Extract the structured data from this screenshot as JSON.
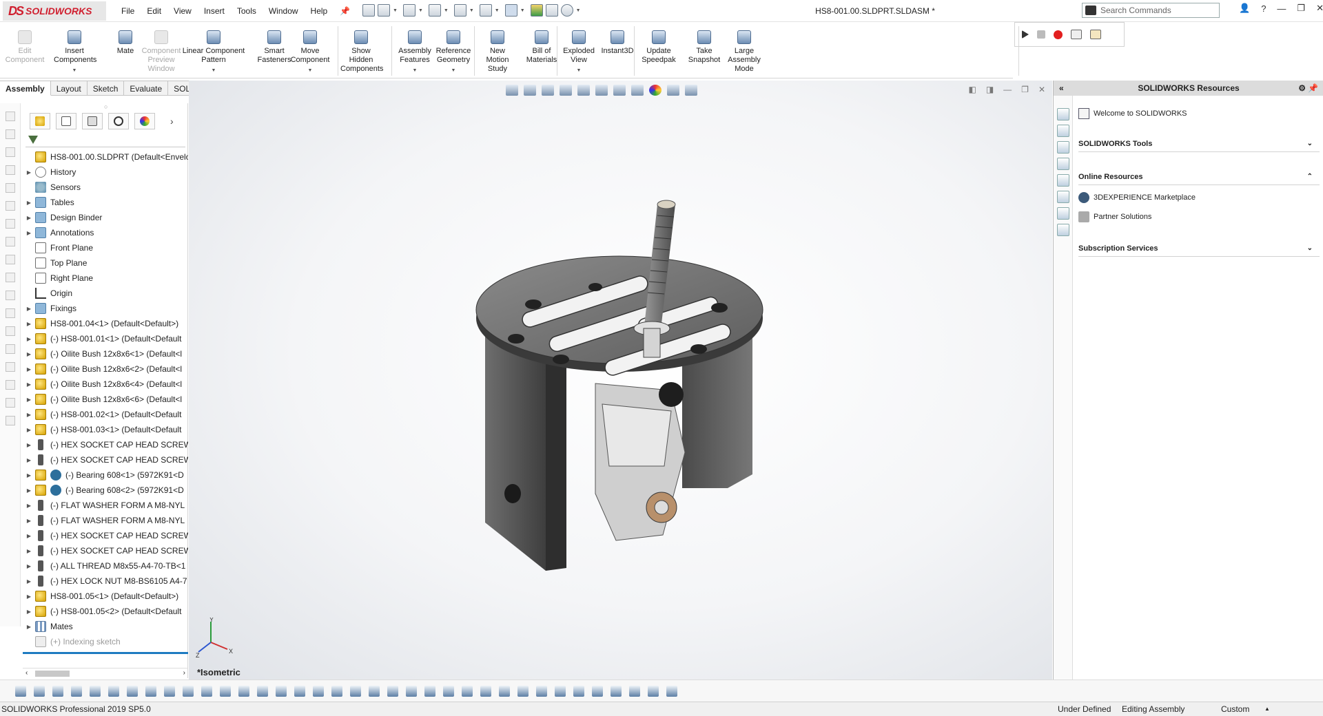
{
  "app": {
    "logo_text": "SOLIDWORKS",
    "document_title": "HS8-001.00.SLDPRT.SLDASM *"
  },
  "menu": [
    "File",
    "Edit",
    "View",
    "Insert",
    "Tools",
    "Window",
    "Help"
  ],
  "search": {
    "placeholder": "Search Commands"
  },
  "commands": [
    {
      "label": "Edit\nComponent",
      "disabled": true,
      "dropdown": false
    },
    {
      "label": "Insert\nComponents",
      "disabled": false,
      "dropdown": true
    },
    {
      "label": "Mate",
      "disabled": false,
      "dropdown": false
    },
    {
      "label": "Component\nPreview\nWindow",
      "disabled": true,
      "dropdown": false
    },
    {
      "label": "Linear Component\nPattern",
      "disabled": false,
      "dropdown": true
    },
    {
      "label": "Smart\nFasteners",
      "disabled": false,
      "dropdown": false
    },
    {
      "label": "Move\nComponent",
      "disabled": false,
      "dropdown": true
    },
    {
      "label": "Show\nHidden\nComponents",
      "disabled": false,
      "dropdown": false
    },
    {
      "label": "Assembly\nFeatures",
      "disabled": false,
      "dropdown": true
    },
    {
      "label": "Reference\nGeometry",
      "disabled": false,
      "dropdown": true
    },
    {
      "label": "New\nMotion\nStudy",
      "disabled": false,
      "dropdown": false
    },
    {
      "label": "Bill of\nMaterials",
      "disabled": false,
      "dropdown": false
    },
    {
      "label": "Exploded\nView",
      "disabled": false,
      "dropdown": true
    },
    {
      "label": "Instant3D",
      "disabled": false,
      "dropdown": false
    },
    {
      "label": "Update\nSpeedpak",
      "disabled": false,
      "dropdown": false
    },
    {
      "label": "Take\nSnapshot",
      "disabled": false,
      "dropdown": false
    },
    {
      "label": "Large\nAssembly\nMode",
      "disabled": false,
      "dropdown": false
    }
  ],
  "tabs": [
    {
      "label": "Assembly",
      "active": true
    },
    {
      "label": "Layout",
      "active": false
    },
    {
      "label": "Sketch",
      "active": false
    },
    {
      "label": "Evaluate",
      "active": false
    },
    {
      "label": "SOLIDWORKS Add-Ins",
      "active": false
    }
  ],
  "tree": {
    "root": "HS8-001.00.SLDPRT  (Default<Envelo",
    "items": [
      {
        "label": "History",
        "icon": "history-icon",
        "expandable": true
      },
      {
        "label": "Sensors",
        "icon": "sensor-icon",
        "expandable": false
      },
      {
        "label": "Tables",
        "icon": "folder-icon",
        "expandable": true
      },
      {
        "label": "Design Binder",
        "icon": "folder-icon",
        "expandable": true
      },
      {
        "label": "Annotations",
        "icon": "folder-icon",
        "expandable": true
      },
      {
        "label": "Front Plane",
        "icon": "plane-icon",
        "expandable": false
      },
      {
        "label": "Top Plane",
        "icon": "plane-icon",
        "expandable": false
      },
      {
        "label": "Right Plane",
        "icon": "plane-icon",
        "expandable": false
      },
      {
        "label": "Origin",
        "icon": "origin-icon",
        "expandable": false
      },
      {
        "label": "Fixings",
        "icon": "folder-icon",
        "expandable": true
      },
      {
        "label": "HS8-001.04<1> (Default<Default>)",
        "icon": "part-icon",
        "expandable": true
      },
      {
        "label": "(-) HS8-001.01<1> (Default<Default",
        "icon": "part-icon",
        "expandable": true
      },
      {
        "label": "(-) Oilite Bush 12x8x6<1> (Default<l",
        "icon": "part-icon",
        "expandable": true
      },
      {
        "label": "(-) Oilite Bush 12x8x6<2> (Default<l",
        "icon": "part-icon",
        "expandable": true
      },
      {
        "label": "(-) Oilite Bush 12x8x6<4> (Default<l",
        "icon": "part-icon",
        "expandable": true
      },
      {
        "label": "(-) Oilite Bush 12x8x6<6> (Default<l",
        "icon": "part-icon",
        "expandable": true
      },
      {
        "label": "(-) HS8-001.02<1> (Default<Default",
        "icon": "part-icon",
        "expandable": true
      },
      {
        "label": "(-) HS8-001.03<1> (Default<Default",
        "icon": "part-icon",
        "expandable": true
      },
      {
        "label": "(-) HEX SOCKET CAP HEAD SCREW I",
        "icon": "screw-icon",
        "expandable": true
      },
      {
        "label": "(-) HEX SOCKET CAP HEAD SCREW I",
        "icon": "screw-icon",
        "expandable": true
      },
      {
        "label": "(-) Bearing 608<1> (5972K91<D",
        "icon": "part-toolbox-icon",
        "expandable": true
      },
      {
        "label": "(-) Bearing 608<2> (5972K91<D",
        "icon": "part-toolbox-icon",
        "expandable": true
      },
      {
        "label": "(-) FLAT WASHER FORM A M8-NYL",
        "icon": "screw-icon",
        "expandable": true
      },
      {
        "label": "(-) FLAT WASHER FORM A M8-NYL",
        "icon": "screw-icon",
        "expandable": true
      },
      {
        "label": "(-) HEX SOCKET CAP HEAD SCREW I",
        "icon": "screw-icon",
        "expandable": true
      },
      {
        "label": "(-) HEX SOCKET CAP HEAD SCREW I",
        "icon": "screw-icon",
        "expandable": true
      },
      {
        "label": "(-) ALL THREAD M8x55-A4-70-TB<1",
        "icon": "screw-icon",
        "expandable": true
      },
      {
        "label": "(-) HEX LOCK NUT M8-BS6105 A4-7",
        "icon": "screw-icon",
        "expandable": true
      },
      {
        "label": "HS8-001.05<1> (Default<Default>)",
        "icon": "part-icon",
        "expandable": true
      },
      {
        "label": "(-) HS8-001.05<2> (Default<Default",
        "icon": "part-icon",
        "expandable": true
      },
      {
        "label": "Mates",
        "icon": "mates-icon",
        "expandable": true
      },
      {
        "label": "(+) Indexing sketch",
        "icon": "sketch-3d-icon",
        "expandable": false,
        "gray": true
      }
    ]
  },
  "viewport": {
    "view_label": "*Isometric",
    "triad": {
      "x": "X",
      "y": "Y",
      "z": "Z"
    }
  },
  "taskpane": {
    "title": "SOLIDWORKS Resources",
    "welcome": "Welcome to SOLIDWORKS",
    "sections": [
      {
        "title": "SOLIDWORKS Tools",
        "expanded": false,
        "items": []
      },
      {
        "title": "Online Resources",
        "expanded": true,
        "items": [
          "3DEXPERIENCE Marketplace",
          "Partner Solutions"
        ]
      },
      {
        "title": "Subscription Services",
        "expanded": false,
        "items": []
      }
    ]
  },
  "status": {
    "product": "SOLIDWORKS Professional 2019 SP5.0",
    "defined": "Under Defined",
    "mode": "Editing Assembly",
    "units": "Custom"
  },
  "colors": {
    "accent_red": "#d01f2f",
    "selection_blue": "#1e7bc1"
  }
}
